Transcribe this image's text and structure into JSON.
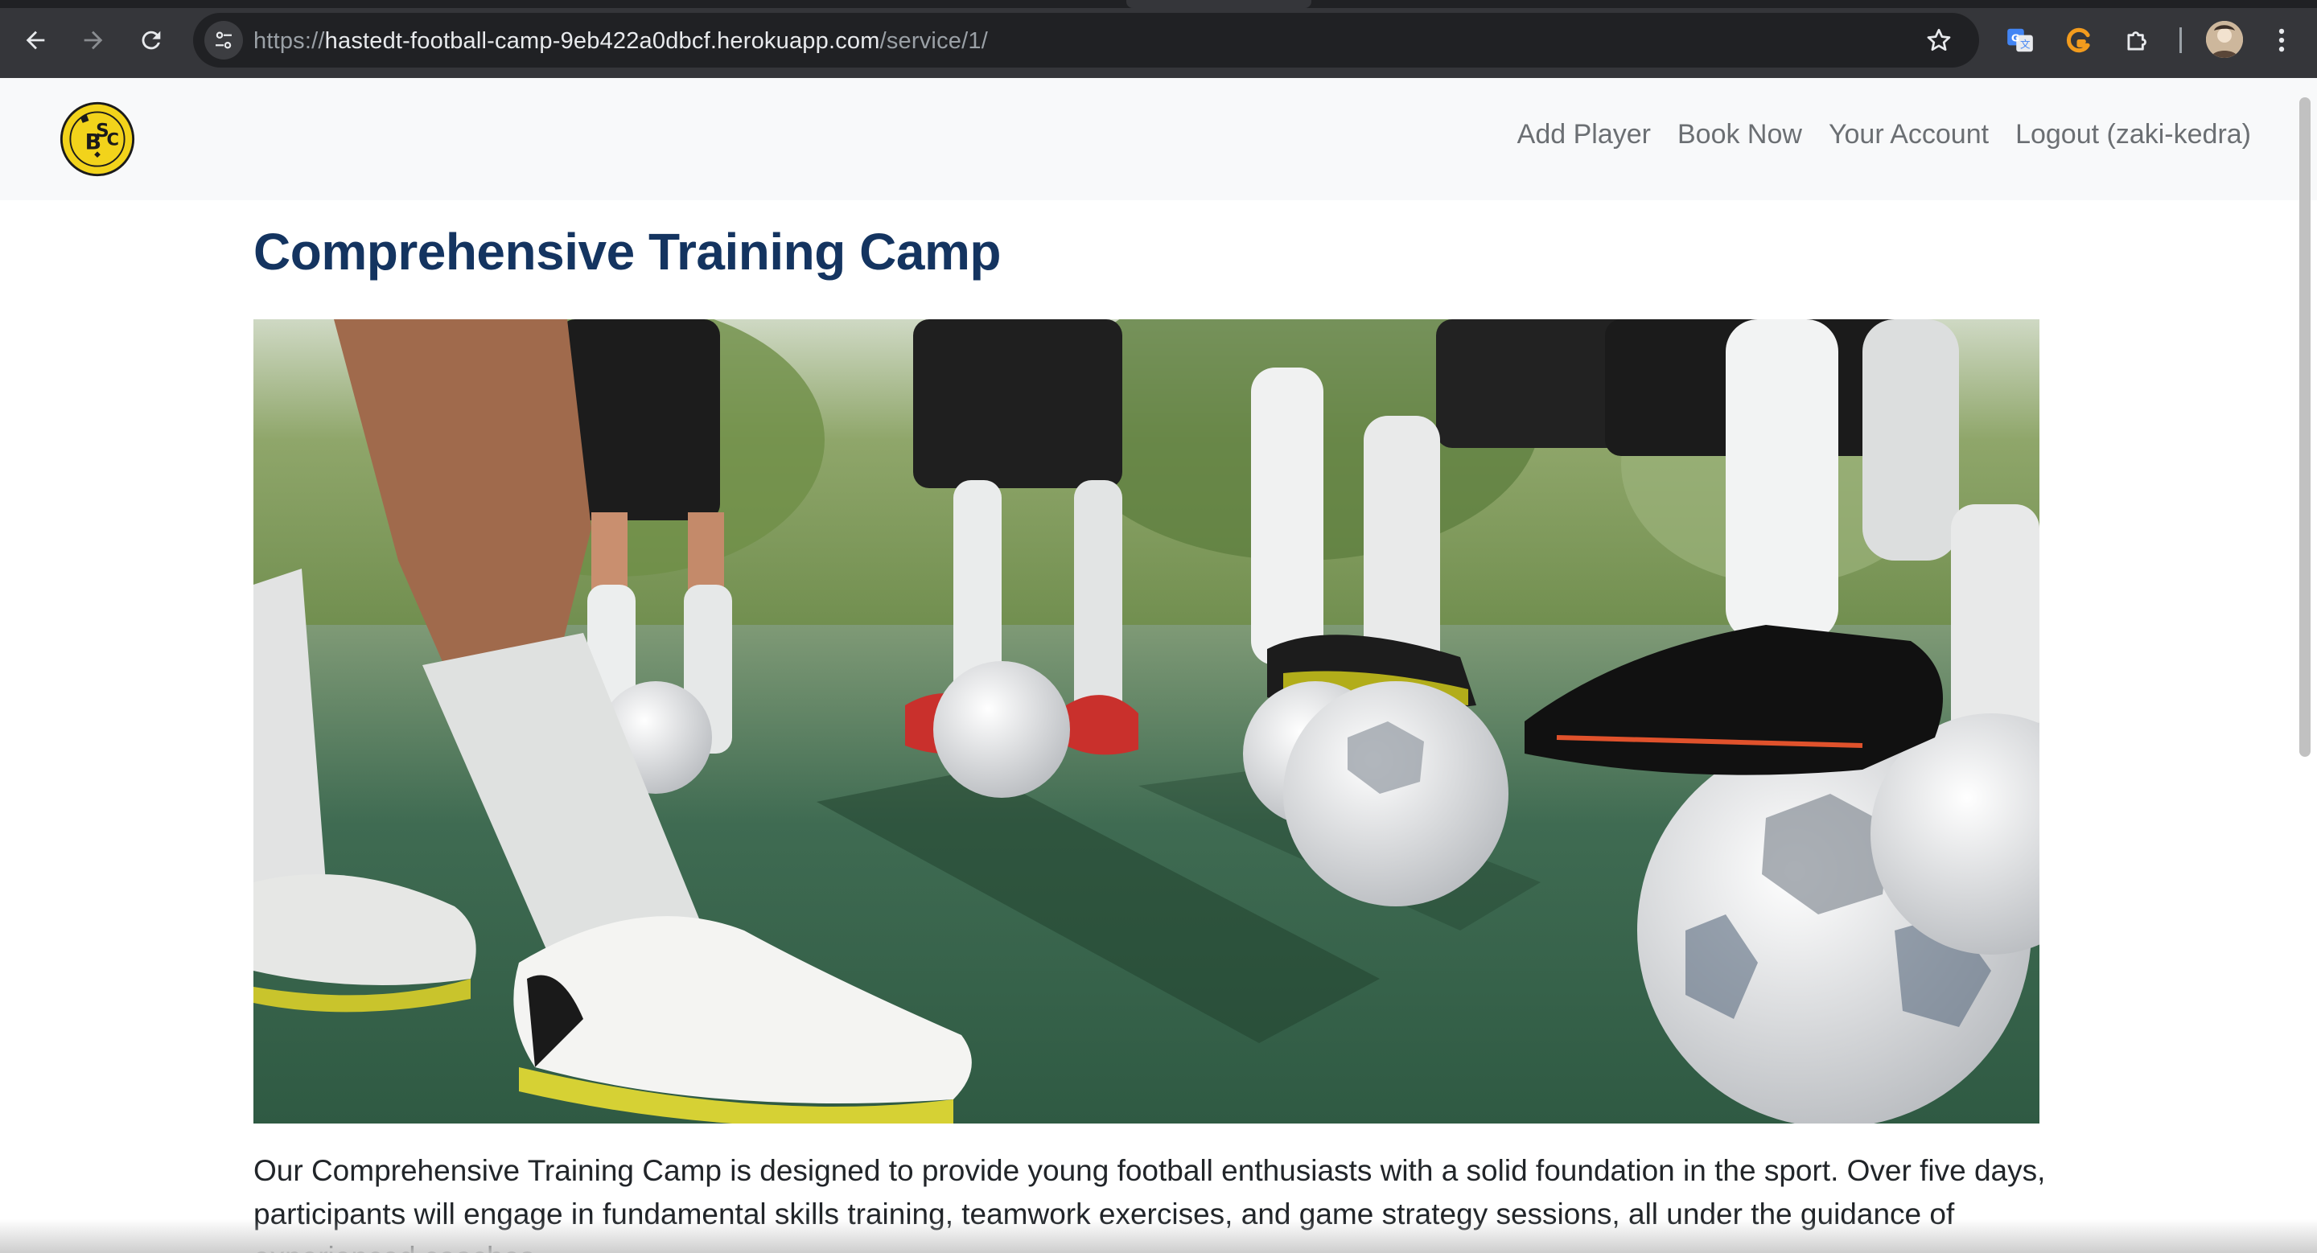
{
  "browser": {
    "url_scheme": "https://",
    "url_host": "hastedt-football-camp-9eb422a0dbcf.herokuapp.com",
    "url_path": "/service/1/",
    "icons": {
      "back": "back-arrow-icon",
      "forward": "forward-arrow-icon",
      "reload": "reload-icon",
      "site_info": "site-info-icon",
      "bookmark": "star-icon",
      "translate": "translate-icon",
      "extension_g": "grammar-extension-icon",
      "extensions": "puzzle-icon",
      "profile": "profile-avatar",
      "menu": "kebab-menu-icon"
    }
  },
  "navbar": {
    "logo_text": "BSC",
    "links": [
      "Add Player",
      "Book Now",
      "Your Account",
      "Logout (zaki-kedra)"
    ]
  },
  "service": {
    "title": "Comprehensive Training Camp",
    "image_subject": "football-players-with-balls",
    "description": "Our Comprehensive Training Camp is designed to provide young football enthusiasts with a solid foundation in the sport. Over five days, participants will engage in fundamental skills training, teamwork exercises, and game strategy sessions, all under the guidance of experienced coaches."
  },
  "colors": {
    "title": "#143460",
    "nav_link": "#6b6f73",
    "navbar_bg": "#f8f9fa",
    "chrome_bg": "#35363a",
    "logo_yellow": "#f2d31b"
  }
}
